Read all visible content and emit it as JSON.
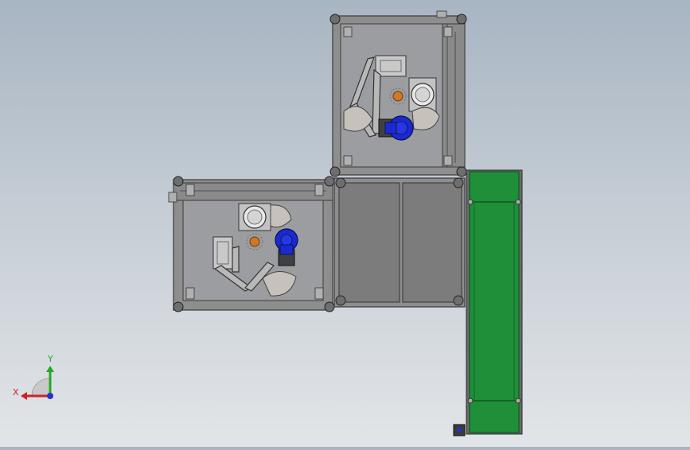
{
  "viewport": {
    "name": "cad-model-view-top",
    "background_top": "#a8b5c2",
    "background_bottom": "#e2e5e8"
  },
  "triad": {
    "x_label": "X",
    "y_label": "Y",
    "x_color": "#cc2222",
    "y_color": "#22aa22",
    "z_color": "#2233cc"
  },
  "model": {
    "frame_color": "#8e8e8e",
    "frame_dark": "#4a4a4a",
    "panel_color": "#7a7a7a",
    "plate_color": "#9a9c9e",
    "motor_color": "#1a2ad0",
    "conveyor_color": "#1f8f3a",
    "conveyor_edge": "#0f5a20"
  }
}
